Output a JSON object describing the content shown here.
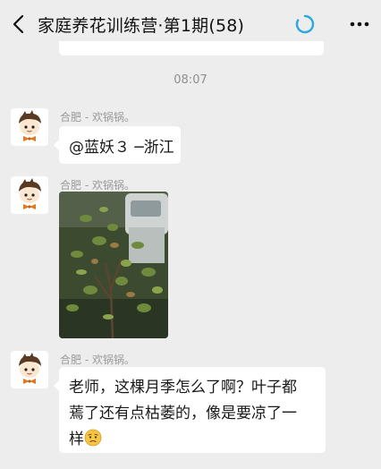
{
  "header": {
    "title": "家庭养花训练营·第1期(58)",
    "back_icon": "chevron-left-icon",
    "loading_icon": "loading-spinner-icon",
    "more_icon": "more-dots-icon"
  },
  "timestamp": "08:07",
  "messages": [
    {
      "sender": "合肥 - 欢锅锅。",
      "type": "text",
      "text": "@蓝妖３ ─浙江"
    },
    {
      "sender": "合肥 - 欢锅锅。",
      "type": "image",
      "image": "rose-bush-photo"
    },
    {
      "sender": "合肥 - 欢锅锅。",
      "type": "text",
      "lines": [
        "老师，这棵月季怎么了啊？叶子都",
        "蔫了还有点枯萎的，像是要凉了一",
        "样"
      ],
      "emoji": "worried-face-emoji"
    }
  ],
  "colors": {
    "background": "#ededed",
    "bubble": "#ffffff",
    "spinner": "#2aa8e0",
    "meta_text": "#9a9a9a"
  }
}
